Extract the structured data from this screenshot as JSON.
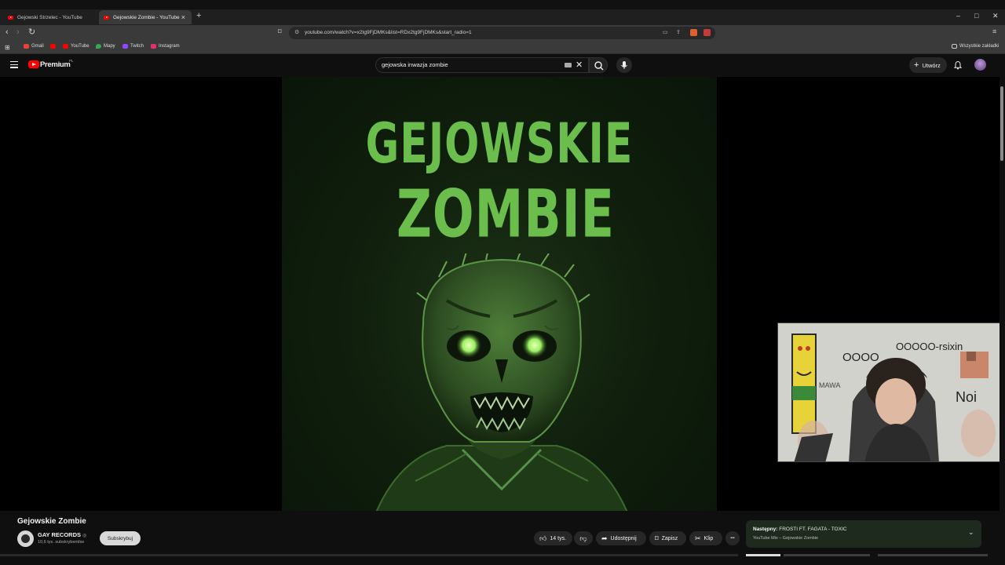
{
  "browser": {
    "tabs": [
      {
        "title": "Gejowski Strzelec - YouTube",
        "active": false
      },
      {
        "title": "Gejowskie Zombie - YouTube",
        "active": true
      }
    ],
    "new_tab": "+",
    "window_controls": {
      "minimize": "–",
      "restore": "□",
      "close": "✕"
    },
    "url": "youtube.com/watch?v=x2tg9FjDMKs&list=RDx2tg9FjDMKs&start_radio=1",
    "bookmarks": [
      {
        "label": "Gmail",
        "icon": "gmail-icon",
        "color": "#ea4335"
      },
      {
        "label": "",
        "icon": "youtube-icon",
        "color": "#ff0000"
      },
      {
        "label": "YouTube",
        "icon": "youtube-icon",
        "color": "#ff0000"
      },
      {
        "label": "Mapy",
        "icon": "maps-icon",
        "color": "#34a853"
      },
      {
        "label": "Twitch",
        "icon": "twitch-icon",
        "color": "#9146ff"
      },
      {
        "label": "Instagram",
        "icon": "instagram-icon",
        "color": "#e1306c"
      }
    ],
    "all_bookmarks": "Wszystkie zakładki"
  },
  "youtube": {
    "logo_text": "Premium",
    "logo_region": "PL",
    "search": {
      "value": "gejowska inwazja zombie"
    },
    "create_label": "Utwórz"
  },
  "video": {
    "cover_line1": "GEJOWSKIE",
    "cover_line2": "ZOMBIE",
    "title": "Gejowskie Zombie",
    "channel": {
      "name": "GAY RECORDS",
      "verified_icon": "◎",
      "subscribers": "10,6 tys. subskrybentów"
    },
    "subscribe_label": "Subskrybuj",
    "likes": "14 tys.",
    "share_label": "Udostępnij",
    "save_label": "Zapisz",
    "clip_label": "Klip",
    "more": "•••"
  },
  "up_next": {
    "prefix": "Następny:",
    "track": "FROSTI FT. FAGATA - TOXIC",
    "source": "YouTube Mix – Gejowskie Zombie"
  },
  "webcam": {
    "wall_text_1": "OOOO",
    "wall_text_2": "OOOOO-rsixin",
    "wall_text_3": "MAWA",
    "wall_text_4": "Noi"
  },
  "colors": {
    "accent_red": "#ff0000",
    "cover_green": "#6bbd4c",
    "up_next_bg": "#1d2a1d"
  }
}
